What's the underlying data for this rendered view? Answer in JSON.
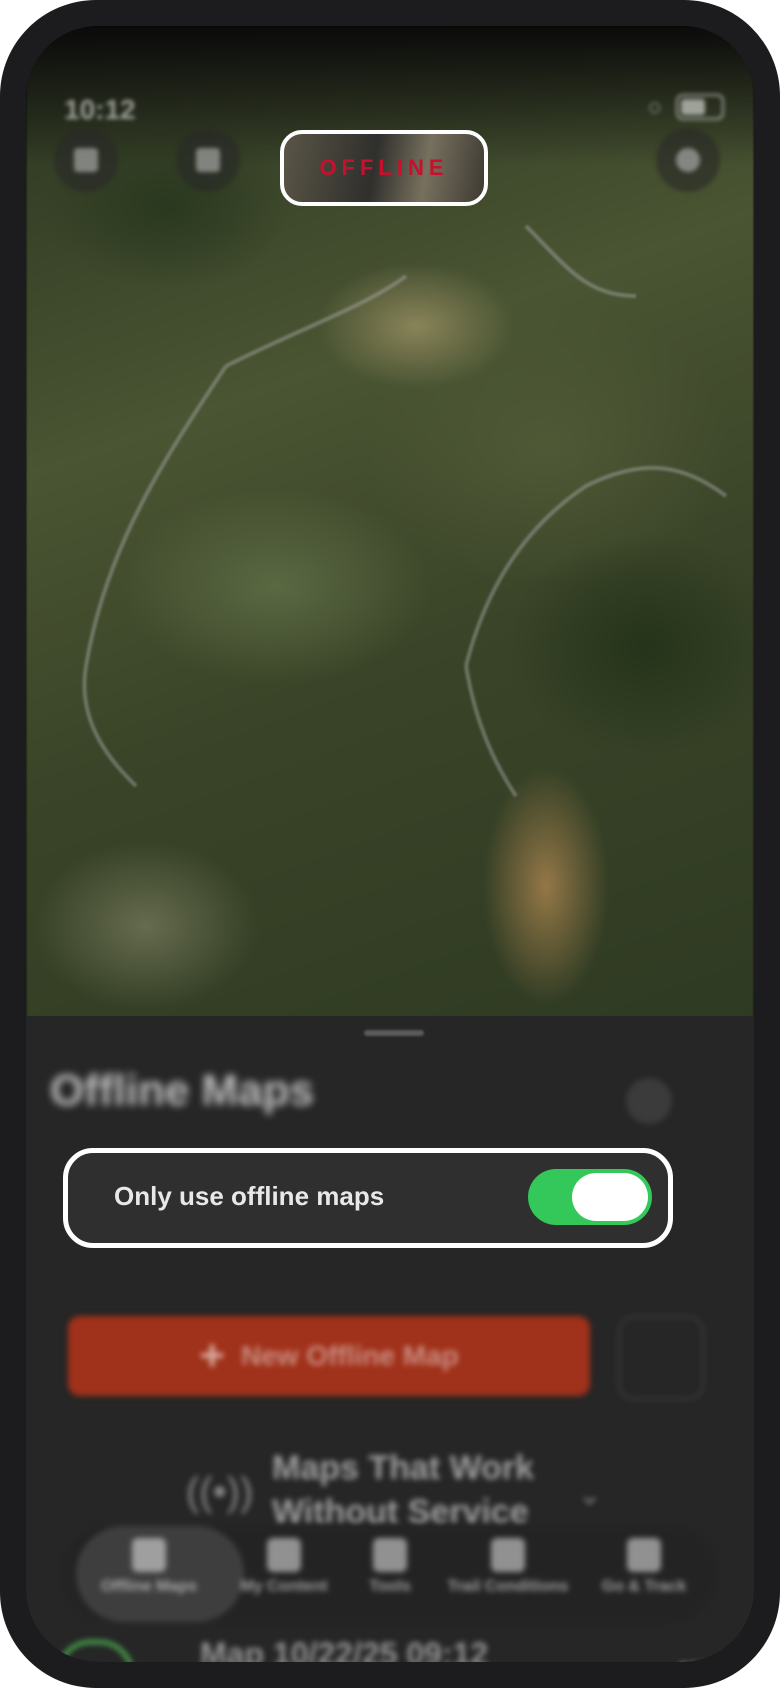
{
  "status_bar": {
    "time": "10:12"
  },
  "map": {
    "badge_label": "OFFLINE"
  },
  "sheet": {
    "title": "Offline Maps",
    "toggle_label": "Only use offline maps",
    "toggle_on": true,
    "new_map_button": "New Offline Map",
    "promo_text": "Maps That Work Without Service"
  },
  "tabs": [
    {
      "label": "Offline Maps",
      "icon": "offline-maps-icon"
    },
    {
      "label": "My Content",
      "icon": "folder-icon"
    },
    {
      "label": "Tools",
      "icon": "tools-icon"
    },
    {
      "label": "Trail Conditions",
      "icon": "trail-conditions-icon"
    },
    {
      "label": "Go & Track",
      "icon": "track-icon"
    }
  ],
  "list": [
    {
      "title": "Map 10/22/25 09:12"
    }
  ],
  "colors": {
    "toggle_on": "#34c759",
    "offline_text": "#c8102e",
    "primary_button": "#a0311a"
  }
}
